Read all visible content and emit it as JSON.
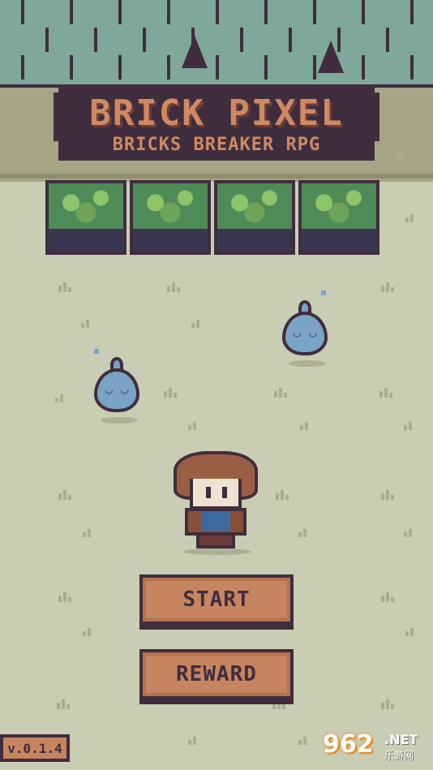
{
  "title": {
    "main": "BRICK PIXEL",
    "subtitle": "BRICKS BREAKER RPG"
  },
  "menu": {
    "start_label": "START",
    "reward_label": "REWARD"
  },
  "version": "v.0.1.4",
  "watermark": {
    "logo": "962",
    "domain": ".NET",
    "site_cn": "乐游网"
  },
  "colors": {
    "wall": "#7fa89a",
    "outline": "#3f2d3d",
    "ground": "#c9cdb4",
    "button": "#c68560",
    "title_text": "#cf8a63",
    "slime": "#7ba3c6",
    "bush": "#4f8b56"
  },
  "sprites": {
    "slimes": [
      "slime-enemy",
      "slime-enemy"
    ],
    "hero": "hero-character",
    "bushes": [
      "bush",
      "bush",
      "bush",
      "bush"
    ]
  }
}
